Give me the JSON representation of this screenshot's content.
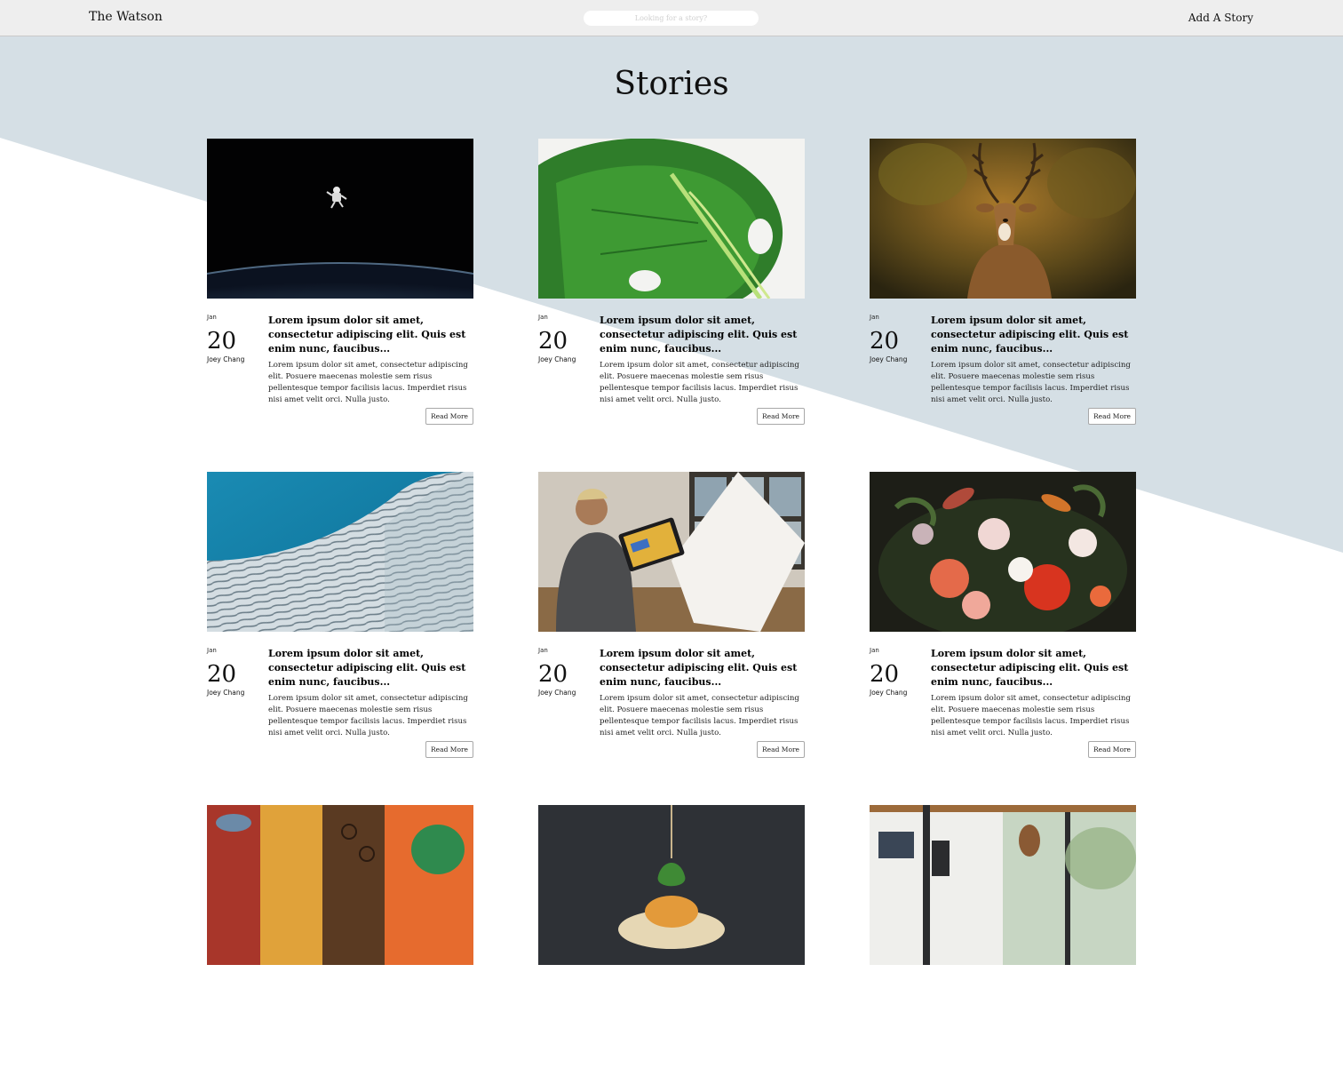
{
  "nav": {
    "brand": "The Watson",
    "search_placeholder": "Looking for a story?",
    "add_story": "Add A Story"
  },
  "page": {
    "title": "Stories"
  },
  "cards": [
    {
      "image": "astronaut-over-earth",
      "month": "Jan",
      "day": "20",
      "author": "Joey Chang",
      "title": "Lorem ipsum dolor sit amet, consectetur adipiscing elit. Quis est enim nunc, faucibus...",
      "excerpt": "Lorem ipsum dolor sit amet, consectetur adipiscing elit. Posuere maecenas molestie sem risus pellentesque tempor facilisis lacus. Imperdiet risus nisi amet velit orci. Nulla justo.",
      "button": "Read More"
    },
    {
      "image": "monstera-leaf",
      "month": "Jan",
      "day": "20",
      "author": "Joey Chang",
      "title": "Lorem ipsum dolor sit amet, consectetur adipiscing elit. Quis est enim nunc, faucibus...",
      "excerpt": "Lorem ipsum dolor sit amet, consectetur adipiscing elit. Posuere maecenas molestie sem risus pellentesque tempor facilisis lacus. Imperdiet risus nisi amet velit orci. Nulla justo.",
      "button": "Read More"
    },
    {
      "image": "deer-in-forest",
      "month": "Jan",
      "day": "20",
      "author": "Joey Chang",
      "title": "Lorem ipsum dolor sit amet, consectetur adipiscing elit. Quis est enim nunc, faucibus...",
      "excerpt": "Lorem ipsum dolor sit amet, consectetur adipiscing elit. Posuere maecenas molestie sem risus pellentesque tempor facilisis lacus. Imperdiet risus nisi amet velit orci. Nulla justo.",
      "button": "Read More"
    },
    {
      "image": "building-facade",
      "month": "Jan",
      "day": "20",
      "author": "Joey Chang",
      "title": "Lorem ipsum dolor sit amet, consectetur adipiscing elit. Quis est enim nunc, faucibus...",
      "excerpt": "Lorem ipsum dolor sit amet, consectetur adipiscing elit. Posuere maecenas molestie sem risus pellentesque tempor facilisis lacus. Imperdiet risus nisi amet velit orci. Nulla justo.",
      "button": "Read More"
    },
    {
      "image": "artist-with-tablet",
      "month": "Jan",
      "day": "20",
      "author": "Joey Chang",
      "title": "Lorem ipsum dolor sit amet, consectetur adipiscing elit. Quis est enim nunc, faucibus...",
      "excerpt": "Lorem ipsum dolor sit amet, consectetur adipiscing elit. Posuere maecenas molestie sem risus pellentesque tempor facilisis lacus. Imperdiet risus nisi amet velit orci. Nulla justo.",
      "button": "Read More"
    },
    {
      "image": "flower-still-life",
      "month": "Jan",
      "day": "20",
      "author": "Joey Chang",
      "title": "Lorem ipsum dolor sit amet, consectetur adipiscing elit. Quis est enim nunc, faucibus...",
      "excerpt": "Lorem ipsum dolor sit amet, consectetur adipiscing elit. Posuere maecenas molestie sem risus pellentesque tempor facilisis lacus. Imperdiet risus nisi amet velit orci. Nulla justo.",
      "button": "Read More"
    },
    {
      "image": "abstract-painting"
    },
    {
      "image": "plated-dish"
    },
    {
      "image": "modern-interior"
    }
  ],
  "colors": {
    "background_accent": "#d5dfe5",
    "topbar": "#eeeeee"
  }
}
